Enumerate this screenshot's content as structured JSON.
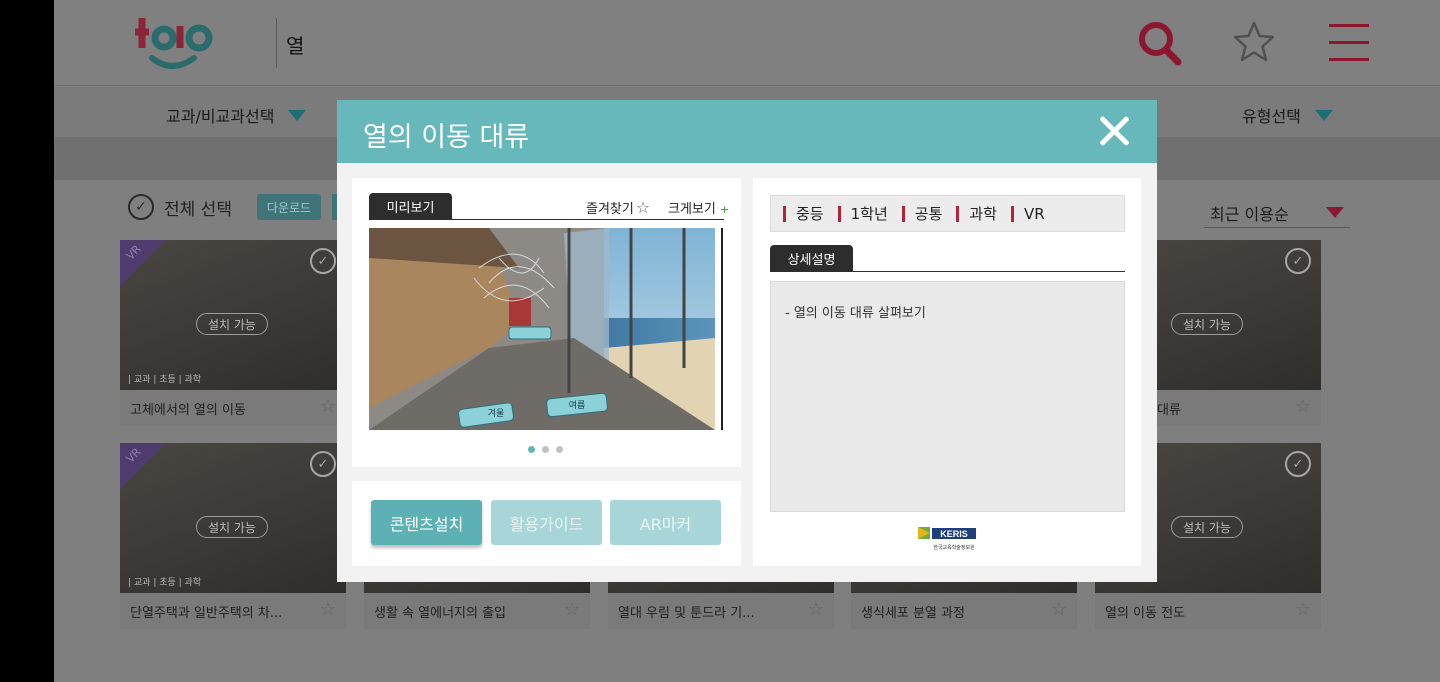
{
  "header": {
    "search_term": "열"
  },
  "filters": {
    "subject": "교과/비교과선택",
    "type": "유형선택"
  },
  "list_controls": {
    "select_all": "전체 선택",
    "download": "다운로드",
    "sort": "최근 이용순"
  },
  "cards": [
    {
      "title": "고체에서의 열의 이동",
      "tags": "| 교과 | 초등 | 과학",
      "install": "설치 가능",
      "badge": "VR"
    },
    {
      "title": "대류",
      "install": "설치 가능"
    },
    {
      "title": "단열주택과 일반주택의 차...",
      "tags": "| 교과 | 초등 | 과학",
      "install": "설치 가능",
      "badge": "VR"
    },
    {
      "title": "생활 속 열에너지의 출입"
    },
    {
      "title": "열대 우림 및 툰드라 기..."
    },
    {
      "title": "생식세포 분열 과정"
    },
    {
      "title": "열의 이동 전도",
      "install": "설치 가능"
    }
  ],
  "modal": {
    "title": "열의 이동 대류",
    "preview_tab": "미리보기",
    "favorite_link": "즐겨찾기",
    "enlarge_link": "크게보기",
    "enlarge_plus": "+",
    "scene_buttons": {
      "cold": "겨울",
      "summer": "여름"
    },
    "carousel": {
      "count": 3,
      "active": 1
    },
    "meta": [
      "중등",
      "1학년",
      "공통",
      "과학",
      "VR"
    ],
    "detail_tab": "상세설명",
    "detail_text": "- 열의 이동 대류 살펴보기",
    "actions": {
      "install": "콘텐츠설치",
      "guide": "활용가이드",
      "ar": "AR마커"
    },
    "publisher": {
      "logo_text": "KERIS",
      "name": "한국교육학술정보원"
    }
  },
  "colors": {
    "accent_teal": "#67b8bb",
    "brand_red": "#8c1830",
    "meta_bar_red": "#b0243d"
  }
}
